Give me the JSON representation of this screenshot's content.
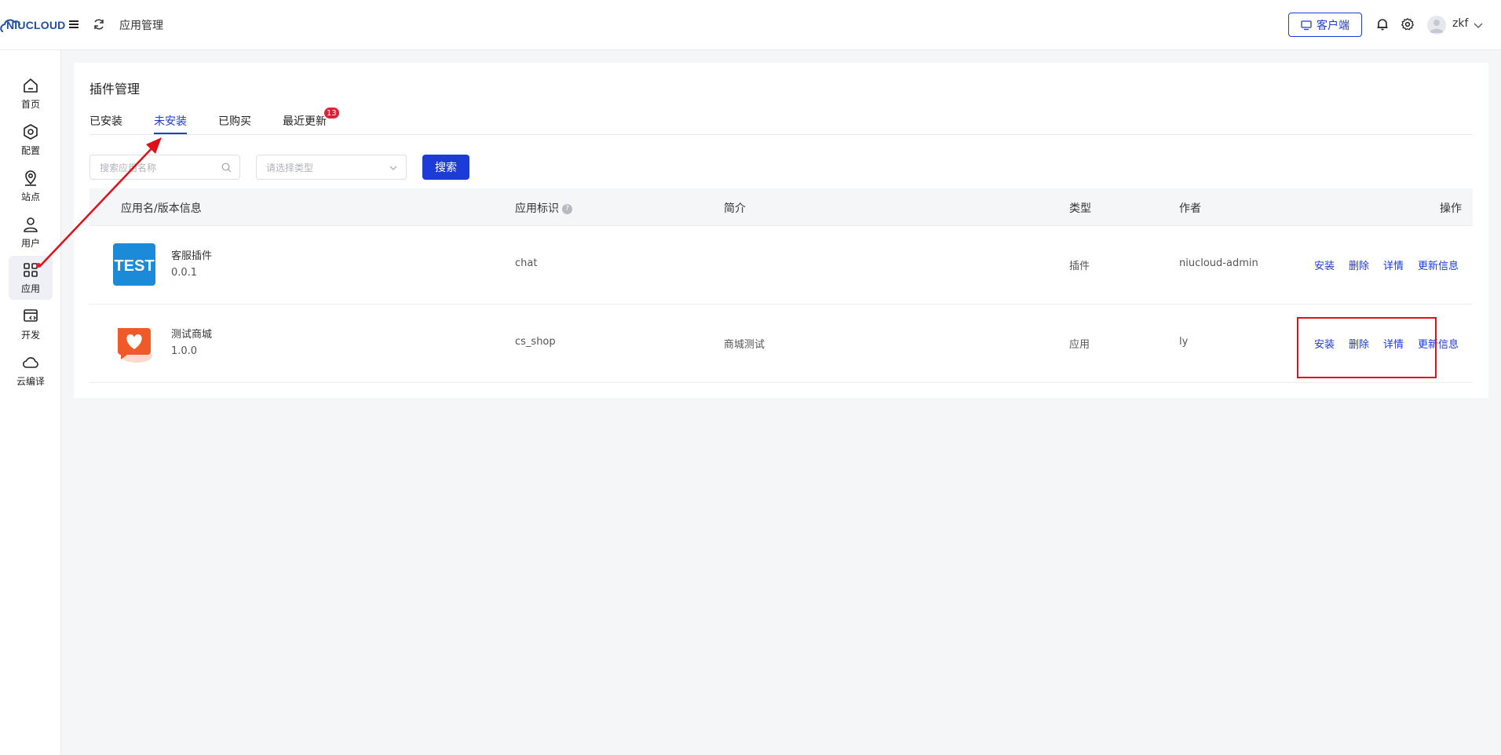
{
  "header": {
    "logo_text": "NIUCLOUD",
    "title": "应用管理",
    "client_button": "客户端",
    "username": "zkf"
  },
  "sidebar": {
    "items": [
      {
        "label": "首页",
        "icon": "home-icon"
      },
      {
        "label": "配置",
        "icon": "hexagon-settings-icon"
      },
      {
        "label": "站点",
        "icon": "location-pin-icon"
      },
      {
        "label": "用户",
        "icon": "user-icon"
      },
      {
        "label": "应用",
        "icon": "apps-grid-icon",
        "active": true
      },
      {
        "label": "开发",
        "icon": "code-window-icon"
      },
      {
        "label": "云编译",
        "icon": "cloud-icon"
      }
    ]
  },
  "page": {
    "title": "插件管理",
    "tabs": [
      {
        "label": "已安装"
      },
      {
        "label": "未安装",
        "active": true
      },
      {
        "label": "已购买"
      },
      {
        "label": "最近更新",
        "badge": "13"
      }
    ],
    "search_placeholder": "搜索应用名称",
    "type_placeholder": "请选择类型",
    "search_button": "搜索"
  },
  "table": {
    "headers": {
      "name": "应用名/版本信息",
      "key": "应用标识",
      "desc": "简介",
      "type": "类型",
      "author": "作者",
      "ops": "操作"
    },
    "rows": [
      {
        "name": "客服插件",
        "version": "0.0.1",
        "key": "chat",
        "desc": "",
        "type": "插件",
        "author": "niucloud-admin",
        "icon_text": "TEST"
      },
      {
        "name": "测试商城",
        "version": "1.0.0",
        "key": "cs_shop",
        "desc": "商城测试",
        "type": "应用",
        "author": "ly"
      }
    ],
    "actions": {
      "install": "安装",
      "delete": "删除",
      "detail": "详情",
      "update": "更新信息"
    }
  },
  "colors": {
    "accent": "#1d3bd6",
    "badge": "#e0203a",
    "annotation": "#e0101a"
  }
}
